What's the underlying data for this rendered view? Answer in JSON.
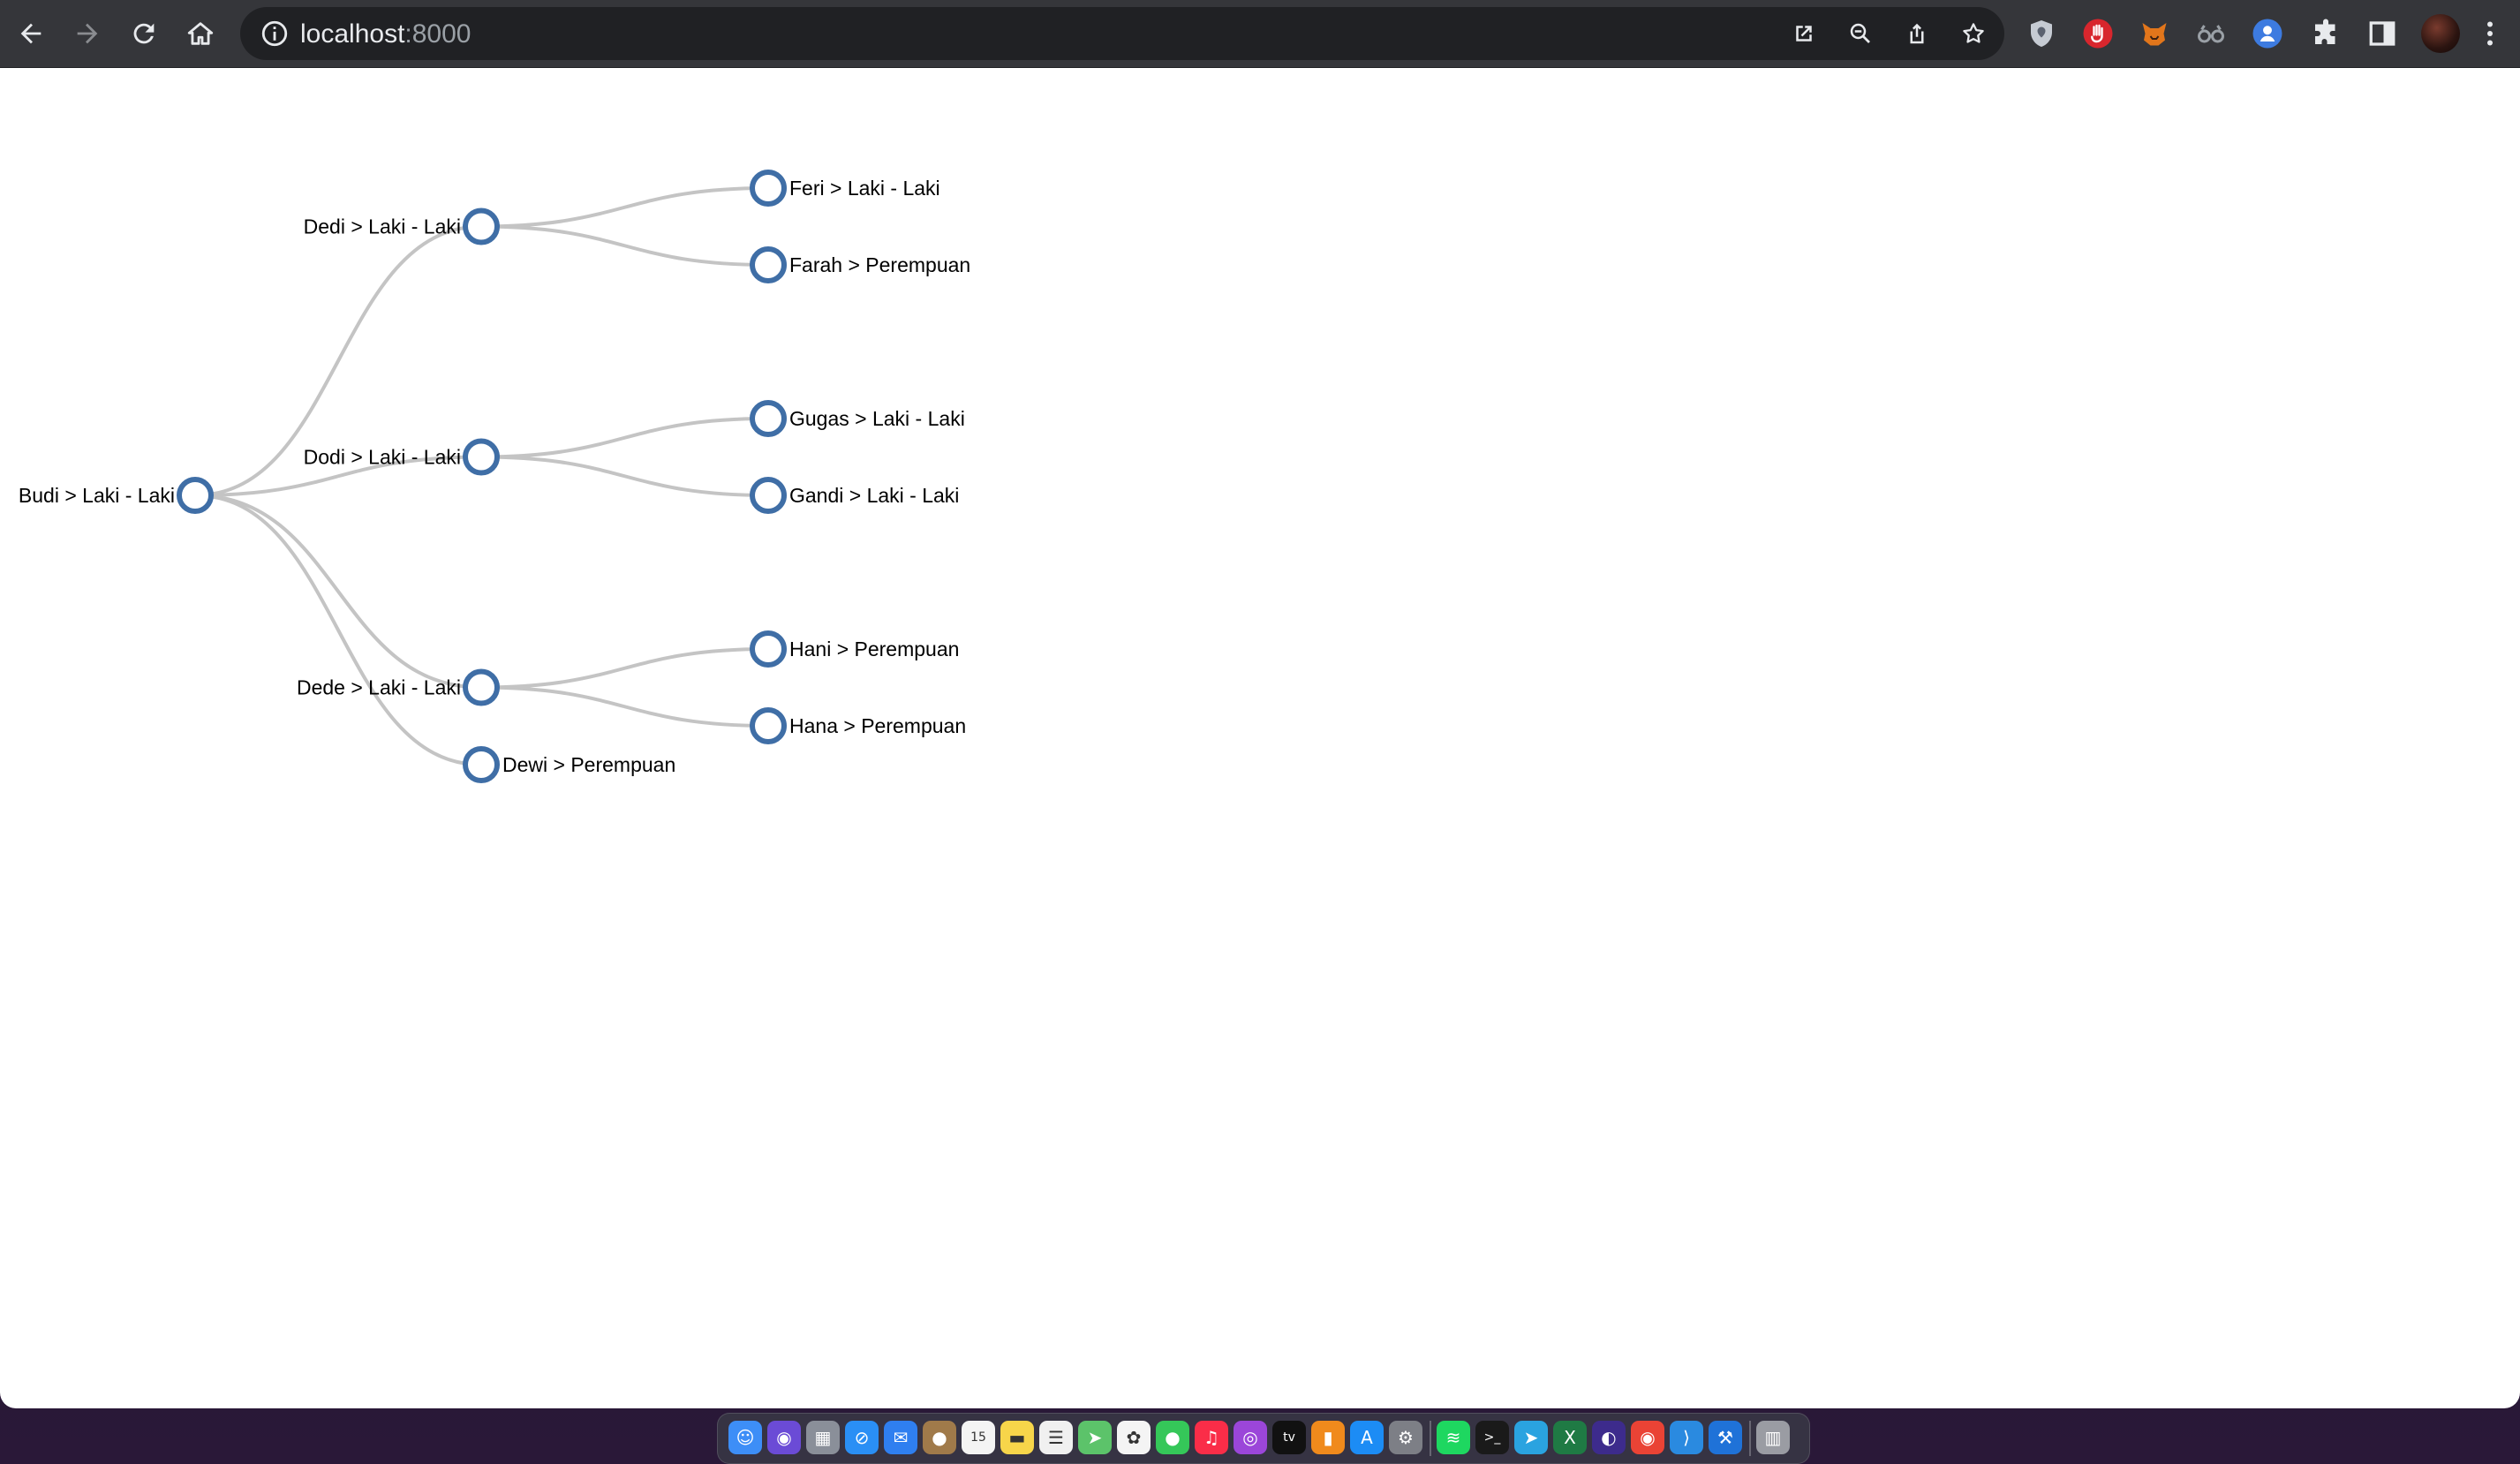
{
  "browser": {
    "url_host": "localhost",
    "url_port": ":8000",
    "nav_icons": [
      "back-icon",
      "forward-icon",
      "reload-icon",
      "home-icon"
    ],
    "omnibox_actions": [
      "open-in-app-icon",
      "zoom-icon",
      "share-icon",
      "bookmark-star-icon"
    ],
    "extensions": [
      "shield-extension-icon",
      "stop-hand-extension-icon",
      "fox-extension-icon",
      "glasses-extension-icon",
      "profile-extension-icon",
      "puzzle-extensions-icon",
      "side-panel-icon"
    ],
    "menu_icon": "kebab-menu-icon"
  },
  "tree": {
    "root": {
      "label": "Budi > Laki - Laki",
      "children": [
        {
          "label": "Dedi > Laki - Laki",
          "children": [
            {
              "label": "Feri > Laki - Laki"
            },
            {
              "label": "Farah > Perempuan"
            }
          ]
        },
        {
          "label": "Dodi > Laki - Laki",
          "children": [
            {
              "label": "Gugas > Laki - Laki"
            },
            {
              "label": "Gandi > Laki - Laki"
            }
          ]
        },
        {
          "label": "Dede > Laki - Laki",
          "children": [
            {
              "label": "Hani > Perempuan"
            },
            {
              "label": "Hana > Perempuan"
            }
          ]
        },
        {
          "label": "Dewi > Perempuan"
        }
      ]
    },
    "colors": {
      "node_stroke": "#3f6ea6",
      "node_fill": "#ffffff",
      "link": "#c4c4c4"
    }
  },
  "dock": {
    "apps": [
      {
        "name": "finder-icon",
        "color": "#3d8ef7",
        "glyph": "☺"
      },
      {
        "name": "siri-icon",
        "color": "#6b4bd6",
        "glyph": "◉"
      },
      {
        "name": "launchpad-icon",
        "color": "#8a8f99",
        "glyph": "▦"
      },
      {
        "name": "safari-icon",
        "color": "#2a8ff5",
        "glyph": "⊘"
      },
      {
        "name": "mail-icon",
        "color": "#2f7ff0",
        "glyph": "✉"
      },
      {
        "name": "contacts-icon",
        "color": "#a07a4a",
        "glyph": "●"
      },
      {
        "name": "calendar-icon",
        "color": "#f4f4f4",
        "glyph": "15"
      },
      {
        "name": "notes-icon",
        "color": "#f7d54a",
        "glyph": "▬"
      },
      {
        "name": "reminders-icon",
        "color": "#f0f0f0",
        "glyph": "☰"
      },
      {
        "name": "maps-icon",
        "color": "#5cc36a",
        "glyph": "➤"
      },
      {
        "name": "photos-icon",
        "color": "#f4f4f4",
        "glyph": "✿"
      },
      {
        "name": "messages-icon",
        "color": "#35c759",
        "glyph": "●"
      },
      {
        "name": "music-icon",
        "color": "#fa2d48",
        "glyph": "♫"
      },
      {
        "name": "podcasts-icon",
        "color": "#9b46d9",
        "glyph": "◎"
      },
      {
        "name": "tv-icon",
        "color": "#111111",
        "glyph": "tv"
      },
      {
        "name": "books-icon",
        "color": "#f08a1c",
        "glyph": "▮"
      },
      {
        "name": "app-store-icon",
        "color": "#1c8cf5",
        "glyph": "A"
      },
      {
        "name": "system-settings-icon",
        "color": "#7d7f86",
        "glyph": "⚙"
      },
      {
        "name": "spotify-icon",
        "color": "#1ed760",
        "glyph": "≋"
      },
      {
        "name": "terminal-icon",
        "color": "#1a1a1a",
        "glyph": ">_"
      },
      {
        "name": "telegram-icon",
        "color": "#2aa3e0",
        "glyph": "➤"
      },
      {
        "name": "excel-icon",
        "color": "#1f7a44",
        "glyph": "X"
      },
      {
        "name": "firefox-icon",
        "color": "#3d2b8c",
        "glyph": "◐"
      },
      {
        "name": "chrome-icon",
        "color": "#ea4335",
        "glyph": "◉"
      },
      {
        "name": "vscode-icon",
        "color": "#2a8ae0",
        "glyph": "⟩"
      },
      {
        "name": "xcode-icon",
        "color": "#1f72d8",
        "glyph": "⚒"
      },
      {
        "name": "trash-icon",
        "color": "#9a9ca3",
        "glyph": "▥"
      }
    ]
  }
}
